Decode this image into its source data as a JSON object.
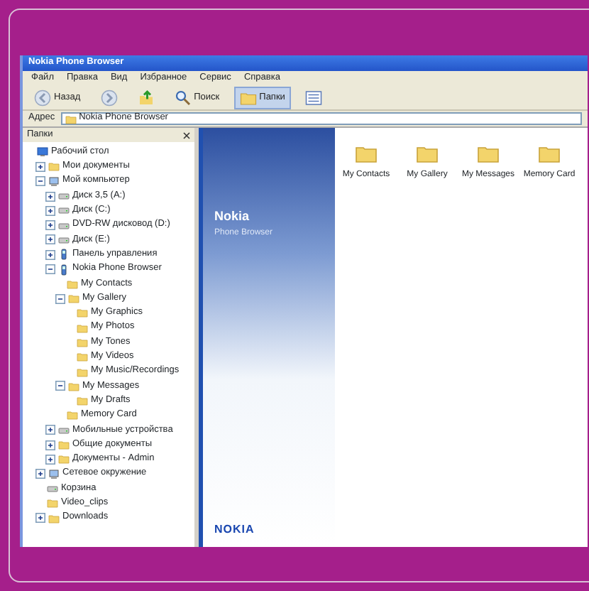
{
  "window": {
    "title": "Nokia Phone Browser"
  },
  "menu": [
    "Файл",
    "Правка",
    "Вид",
    "Избранное",
    "Сервис",
    "Справка"
  ],
  "toolbar": [
    {
      "kind": "back",
      "label": "Назад"
    },
    {
      "kind": "forward"
    },
    {
      "kind": "up"
    },
    {
      "kind": "search",
      "label": "Поиск",
      "selected": false
    },
    {
      "kind": "folders",
      "label": "Папки",
      "selected": true
    },
    {
      "kind": "views"
    }
  ],
  "address": {
    "label": "Адрес",
    "value": "Nokia Phone Browser"
  },
  "folders_pane": {
    "title": "Папки",
    "tree": [
      {
        "label": "Рабочий стол",
        "kind": "desktop",
        "children": [
          {
            "label": "Мои документы",
            "kind": "folder",
            "expanded": false
          },
          {
            "label": "Мой компьютер",
            "kind": "computer",
            "expanded": true,
            "children": [
              {
                "label": "Диск 3,5 (A:)",
                "kind": "drive",
                "expanded": false
              },
              {
                "label": "Диск (C:)",
                "kind": "drive",
                "expanded": false
              },
              {
                "label": "DVD-RW дисковод (D:)",
                "kind": "drive",
                "expanded": false
              },
              {
                "label": "Диск (E:)",
                "kind": "drive",
                "expanded": false
              },
              {
                "label": "Панель управления",
                "kind": "phone",
                "expanded": false
              },
              {
                "label": "Nokia Phone Browser",
                "kind": "phone",
                "expanded": true,
                "children": [
                  {
                    "label": "My Contacts",
                    "kind": "folder"
                  },
                  {
                    "label": "My Gallery",
                    "kind": "folder",
                    "expanded": true,
                    "children": [
                      {
                        "label": "My Graphics",
                        "kind": "folder"
                      },
                      {
                        "label": "My Photos",
                        "kind": "folder"
                      },
                      {
                        "label": "My Tones",
                        "kind": "folder"
                      },
                      {
                        "label": "My Videos",
                        "kind": "folder"
                      },
                      {
                        "label": "My Music/Recordings",
                        "kind": "folder"
                      }
                    ]
                  },
                  {
                    "label": "My Messages",
                    "kind": "folder",
                    "expanded": true,
                    "children": [
                      {
                        "label": "My Drafts",
                        "kind": "folder"
                      }
                    ]
                  },
                  {
                    "label": "Memory Card",
                    "kind": "folder"
                  }
                ]
              },
              {
                "label": "Мобильные устройства",
                "kind": "drive",
                "expanded": false
              },
              {
                "label": "Общие документы",
                "kind": "folder",
                "expanded": false
              },
              {
                "label": "Документы - Admin",
                "kind": "folder",
                "expanded": false
              }
            ]
          },
          {
            "label": "Сетевое окружение",
            "kind": "computer",
            "expanded": false
          },
          {
            "label": "Корзина",
            "kind": "drive"
          },
          {
            "label": "Video_clips",
            "kind": "folder"
          },
          {
            "label": "Downloads",
            "kind": "folder",
            "expanded": false
          }
        ]
      }
    ]
  },
  "banner": {
    "title": "Nokia",
    "subtitle": "Phone Browser",
    "logo": "NOKIA"
  },
  "files": [
    {
      "label": "My Contacts"
    },
    {
      "label": "My Gallery"
    },
    {
      "label": "My Messages"
    },
    {
      "label": "Memory Card"
    }
  ]
}
